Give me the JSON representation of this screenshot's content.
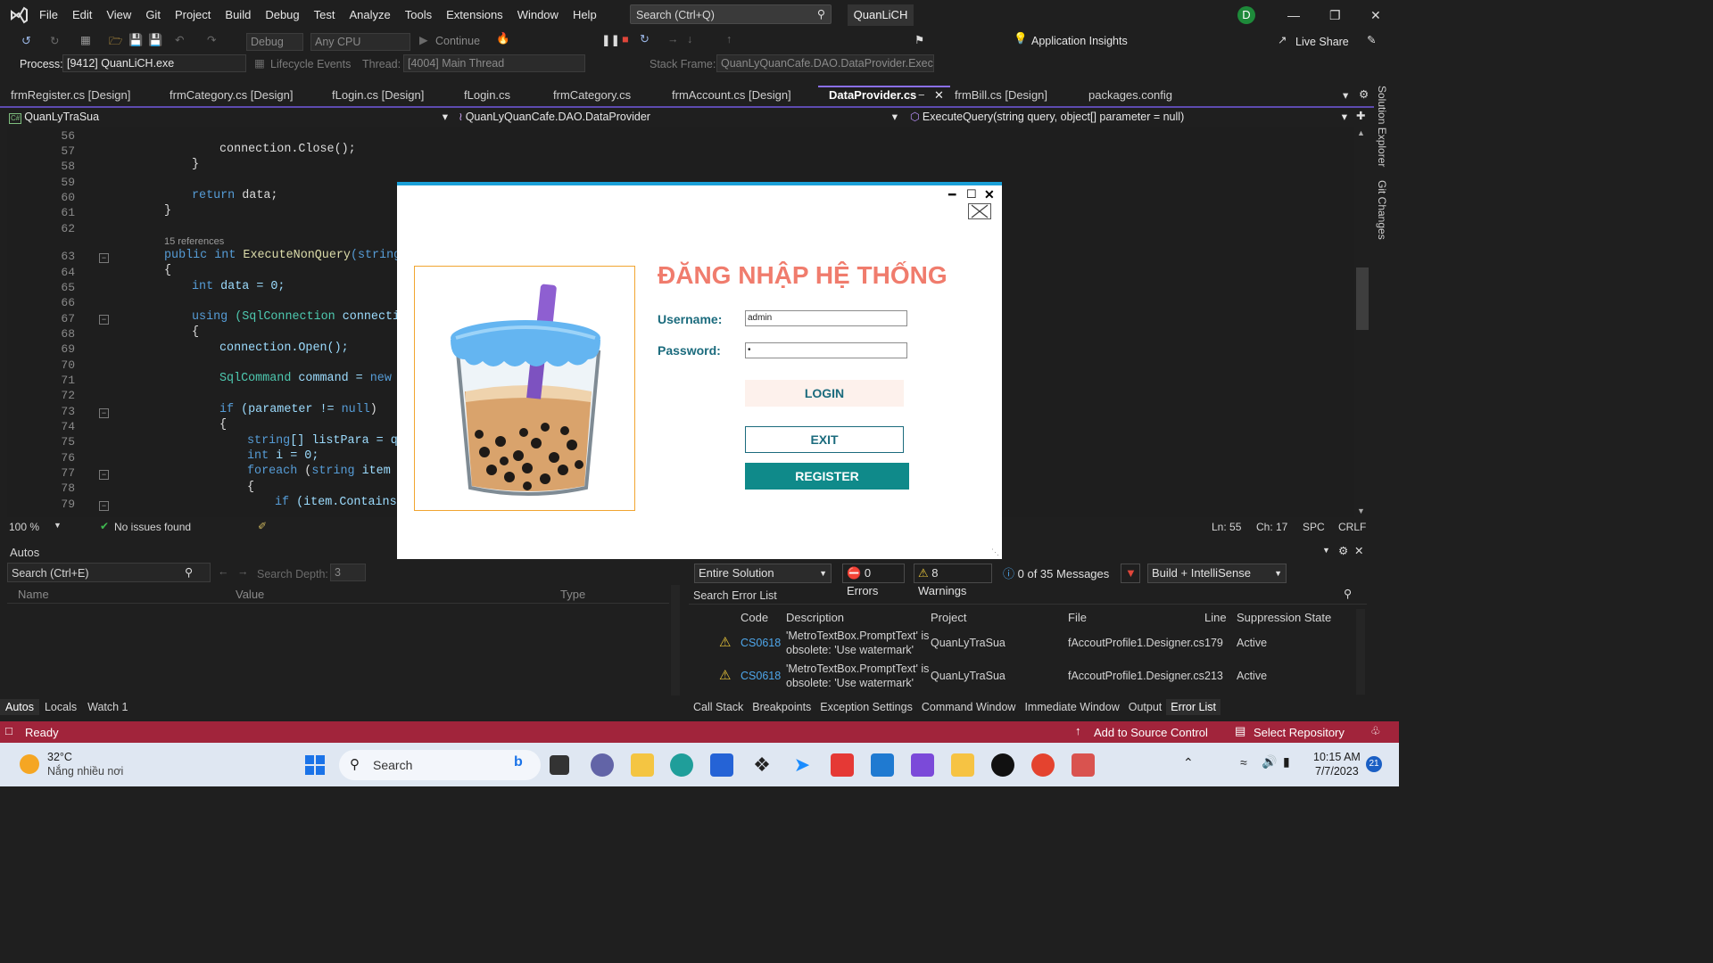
{
  "menu": [
    "File",
    "Edit",
    "View",
    "Git",
    "Project",
    "Build",
    "Debug",
    "Test",
    "Analyze",
    "Tools",
    "Extensions",
    "Window",
    "Help"
  ],
  "search": {
    "placeholder": "Search (Ctrl+Q)"
  },
  "solution_name": "QuanLiCH",
  "avatar_letter": "D",
  "toolbar": {
    "config": "Debug",
    "platform": "Any CPU",
    "continue": "Continue",
    "app_insights": "Application Insights",
    "live_share": "Live Share"
  },
  "debugbar": {
    "process_label": "Process:",
    "process_value": "[9412] QuanLiCH.exe",
    "lifecycle": "Lifecycle Events",
    "thread_label": "Thread:",
    "thread_value": "[4004] Main Thread",
    "stack_label": "Stack Frame:",
    "stack_value": "QuanLyQuanCafe.DAO.DataProvider.Execu"
  },
  "tabs": [
    "frmRegister.cs [Design]",
    "frmCategory.cs [Design]",
    "fLogin.cs [Design]",
    "fLogin.cs",
    "frmCategory.cs",
    "frmAccount.cs [Design]",
    "DataProvider.cs",
    "frmBill.cs [Design]",
    "packages.config"
  ],
  "nav": {
    "project": "QuanLyTraSua",
    "class": "QuanLyQuanCafe.DAO.DataProvider",
    "member": "ExecuteQuery(string query, object[] parameter = null)"
  },
  "side_tabs": [
    "Solution Explorer",
    "Git Changes"
  ],
  "code": {
    "lines": [
      "56",
      "57",
      "58",
      "59",
      "60",
      "61",
      "62",
      "63",
      "64",
      "65",
      "66",
      "67",
      "68",
      "69",
      "70",
      "71",
      "72",
      "73",
      "74",
      "75",
      "76",
      "77",
      "78",
      "79"
    ],
    "references": "15 references",
    "l57": "connection.Close();",
    "l60a": "return",
    "l60b": " data;",
    "l63a": "public",
    "l63b": " int",
    "l63c": " ExecuteNonQuery",
    "l63d": "(string",
    "l65a": "int",
    "l65b": " data = 0;",
    "l67a": "using",
    "l67b": " (SqlConnection",
    "l67c": " connecti",
    "l69": "connection.Open();",
    "l71a": "SqlCommand",
    "l71b": " command = ",
    "l71c": "new",
    "l71d": " S",
    "l73a": "if",
    "l73b": " (parameter != ",
    "l73c": "null",
    "l75a": "string",
    "l75b": "[] listPara = qu",
    "l76a": "int",
    "l76b": " i = 0;",
    "l77a": "foreach",
    "l77b": " (",
    "l77c": "string",
    "l77d": " item i",
    "l79a": "if",
    "l79b": " (item.Contains("
  },
  "editor_status": {
    "zoom": "100 %",
    "issues": "No issues found",
    "ln": "Ln: 55",
    "ch": "Ch: 17",
    "spc": "SPC",
    "crlf": "CRLF"
  },
  "autos": {
    "title": "Autos",
    "search": "Search (Ctrl+E)",
    "depth_label": "Search Depth:",
    "depth": "3",
    "cols": [
      "Name",
      "Value",
      "Type"
    ],
    "tabs": [
      "Autos",
      "Locals",
      "Watch 1"
    ]
  },
  "errors": {
    "scope": "Entire Solution",
    "errors": "0 Errors",
    "warnings": "8 Warnings",
    "messages": "0 of 35 Messages",
    "build": "Build + IntelliSense",
    "search": "Search Error List",
    "cols": [
      "Code",
      "Description",
      "Project",
      "File",
      "Line",
      "Suppression State"
    ],
    "rows": [
      {
        "code": "CS0618",
        "desc1": "'MetroTextBox.PromptText' is",
        "desc2": "obsolete: 'Use watermark'",
        "project": "QuanLyTraSua",
        "file": "fAccoutProfile1.Designer.cs",
        "line": "179",
        "state": "Active"
      },
      {
        "code": "CS0618",
        "desc1": "'MetroTextBox.PromptText' is",
        "desc2": "obsolete: 'Use watermark'",
        "project": "QuanLyTraSua",
        "file": "fAccoutProfile1.Designer.cs",
        "line": "213",
        "state": "Active"
      }
    ],
    "tabs": [
      "Call Stack",
      "Breakpoints",
      "Exception Settings",
      "Command Window",
      "Immediate Window",
      "Output",
      "Error List"
    ]
  },
  "status": {
    "ready": "Ready",
    "source_control": "Add to Source Control",
    "repo": "Select Repository"
  },
  "taskbar": {
    "temp": "32°C",
    "weather": "Nắng nhiều nơi",
    "search": "Search",
    "time": "10:15 AM",
    "date": "7/7/2023",
    "badge": "21"
  },
  "dialog": {
    "title": "ĐĂNG NHẬP HỆ THỐNG",
    "username_label": "Username:",
    "username_value": "admin",
    "password_label": "Password:",
    "password_value": "•",
    "login": "LOGIN",
    "exit": "EXIT",
    "register": "REGISTER",
    "colors": {
      "title": "#f07c6d",
      "label": "#1b6b7d",
      "register_bg": "#0f8a8a",
      "login_bg": "#fdf1ec",
      "top_border": "#1aa0d8"
    }
  }
}
